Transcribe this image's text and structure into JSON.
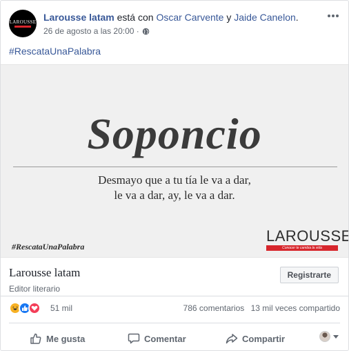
{
  "post": {
    "page_name": "Larousse latam",
    "with_text": "está con",
    "tagged_1": "Oscar Carvente",
    "connector": "y",
    "tagged_2": "Jaide Canelon",
    "period": ".",
    "timestamp": "26 de agosto a las 20:00",
    "separator": "·",
    "privacy_icon": "globe-icon",
    "hashtag": "#RescataUnaPalabra",
    "avatar_logo": "LAROUSSE"
  },
  "image": {
    "word": "Soponcio",
    "definition_line1": "Desmayo que a tu tía le va a dar,",
    "definition_line2": "le va a dar, ay, le va a dar.",
    "hashtag": "#RescataUnaPalabra",
    "brand": "LAROUSSE",
    "brand_tagline": "Conocer te cambia la vida",
    "accent_color": "#d7262c"
  },
  "page_info": {
    "name": "Larousse latam",
    "category": "Editor literario",
    "register_label": "Registrarte"
  },
  "stats": {
    "reactions": [
      "haha",
      "like",
      "love"
    ],
    "reaction_count": "51 mil",
    "comments": "786 comentarios",
    "shares": "13 mil veces compartido"
  },
  "actions": {
    "like_label": "Me gusta",
    "comment_label": "Comentar",
    "share_label": "Compartir",
    "like_icon": "thumbs-up-icon",
    "comment_icon": "comment-bubble-icon",
    "share_icon": "share-arrow-icon"
  },
  "colors": {
    "link": "#385898",
    "secondary_text": "#606770"
  }
}
